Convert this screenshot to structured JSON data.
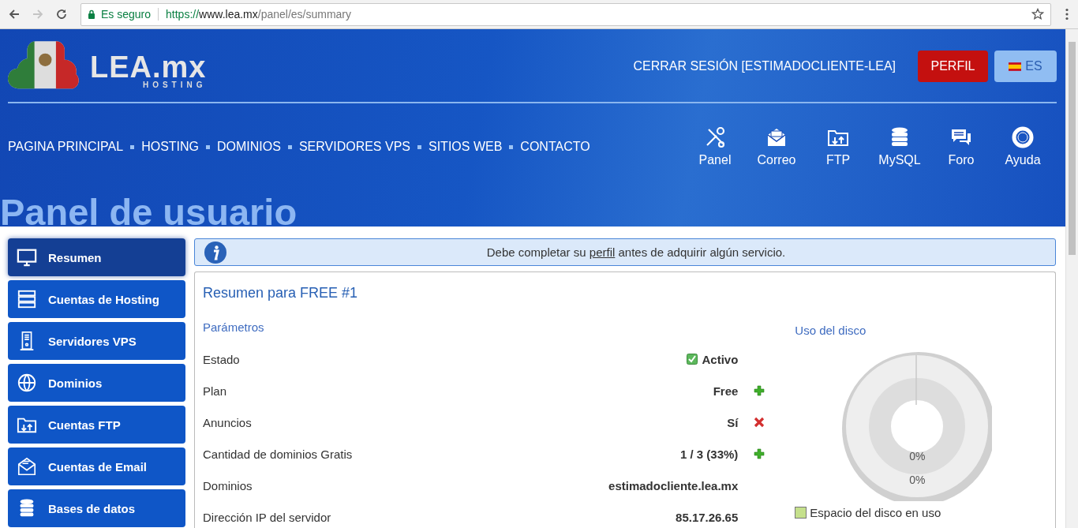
{
  "browser": {
    "nav_buttons": [
      {
        "kind": "back",
        "disabled": false
      },
      {
        "kind": "forward",
        "disabled": true
      },
      {
        "kind": "reload",
        "disabled": false
      }
    ],
    "secure_label": "Es seguro",
    "url": {
      "scheme": "https://",
      "host": "www.lea.mx",
      "path": "/panel/es/summary"
    }
  },
  "header": {
    "logo": {
      "name": "LEA.mx",
      "tagline": "HOSTING"
    },
    "logout": "CERRAR SESIÓN [ESTIMADOCLIENTE-LEA]",
    "profile_button": "PERFIL",
    "language_button": "ES",
    "nav": [
      "PAGINA PRINCIPAL",
      "HOSTING",
      "DOMINIOS",
      "SERVIDORES VPS",
      "SITIOS WEB",
      "CONTACTO"
    ],
    "tools": [
      {
        "label": "Panel"
      },
      {
        "label": "Correo"
      },
      {
        "label": "FTP"
      },
      {
        "label": "MySQL"
      },
      {
        "label": "Foro"
      },
      {
        "label": "Ayuda"
      }
    ],
    "page_title": "Panel de usuario"
  },
  "sidebar": {
    "items": [
      {
        "label": "Resumen",
        "selected": true
      },
      {
        "label": "Cuentas de Hosting",
        "selected": false
      },
      {
        "label": "Servidores VPS",
        "selected": false
      },
      {
        "label": "Dominios",
        "selected": false
      },
      {
        "label": "Cuentas FTP",
        "selected": false
      },
      {
        "label": "Cuentas de Email",
        "selected": false
      },
      {
        "label": "Bases de datos",
        "selected": false
      }
    ]
  },
  "alert": {
    "before": "Debe completar su ",
    "link": "perfil",
    "after": " antes de adquirir algún servicio."
  },
  "summary": {
    "title": "Resumen para FREE #1",
    "section": "Parámetros",
    "rows": [
      {
        "kind": "status",
        "label": "Estado",
        "value": "Activo"
      },
      {
        "kind": "add",
        "label": "Plan",
        "value": "Free"
      },
      {
        "kind": "remove",
        "label": "Anuncios",
        "value": "Sí"
      },
      {
        "kind": "add",
        "label": "Cantidad de dominios Gratis",
        "value": "1 / 3 (33%)"
      },
      {
        "kind": "plain",
        "label": "Dominios",
        "value": "estimadocliente.lea.mx"
      },
      {
        "kind": "plain",
        "label": "Dirección IP del servidor",
        "value": "85.17.26.65"
      }
    ]
  },
  "disk_usage": {
    "title": "Uso del disco",
    "inner_label": "0%",
    "outer_label": "0%",
    "legend": {
      "label": "Espacio del disco en uso",
      "color": "#c5e08c"
    }
  }
}
